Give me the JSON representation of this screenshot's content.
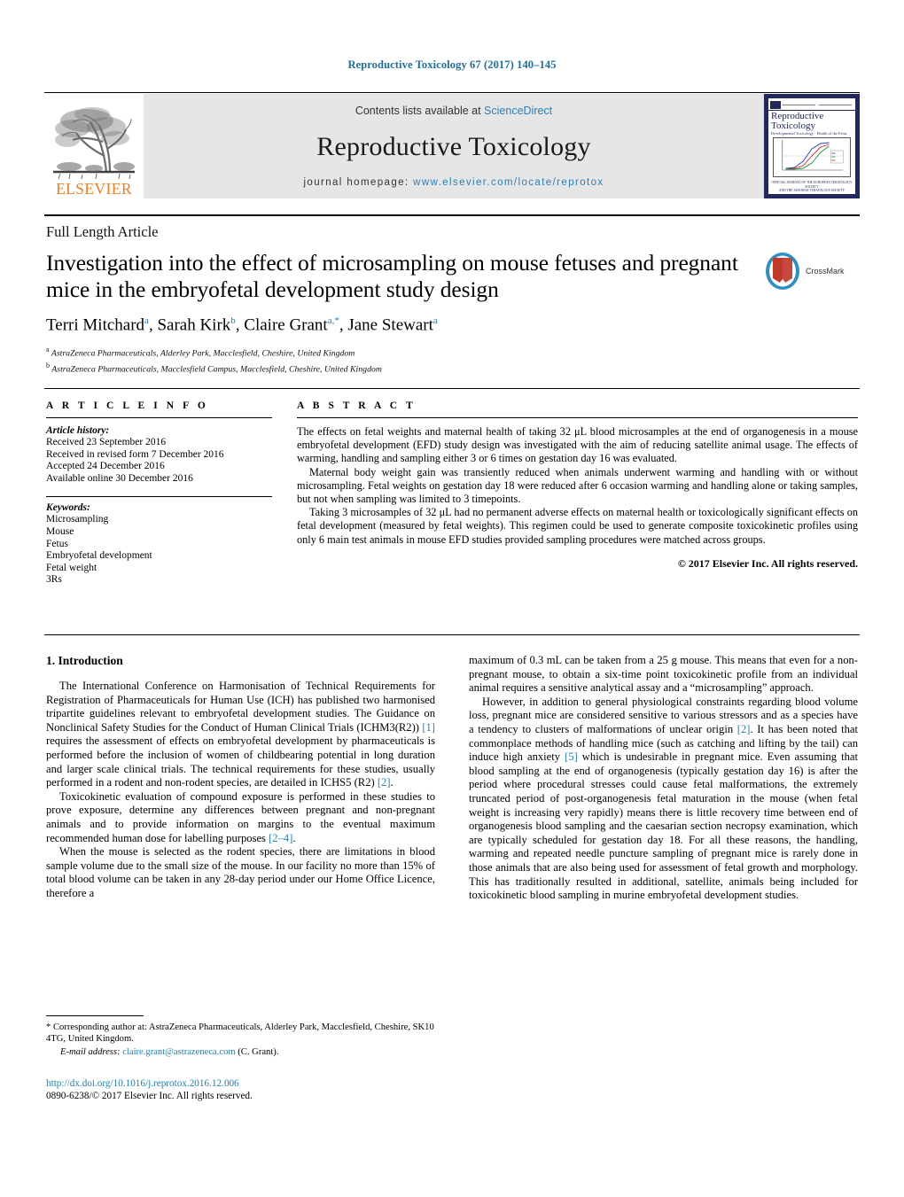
{
  "running_head": "Reproductive Toxicology 67 (2017) 140–145",
  "masthead": {
    "contents_prefix": "Contents lists available at ",
    "sciencedirect": "ScienceDirect",
    "journal_name": "Reproductive Toxicology",
    "homepage_prefix": "journal homepage: ",
    "homepage_url": "www.elsevier.com/locate/reprotox",
    "publisher": "ELSEVIER",
    "cover": {
      "title_line1": "Reproductive",
      "title_line2": "Toxicology",
      "subtitle": "Developmental Toxicology · Health of the Fetus",
      "footer_line1": "OFFICIAL JOURNAL OF THE EUROPEAN TERATOLOGY SOCIETY",
      "footer_line2": "AND THE JAPANESE TERATOLOGY SOCIETY"
    }
  },
  "article": {
    "type": "Full Length Article",
    "title": "Investigation into the effect of microsampling on mouse fetuses and pregnant mice in the embryofetal development study design",
    "authors": [
      {
        "name": "Terri Mitchard",
        "marks": "a",
        "sep": ", "
      },
      {
        "name": "Sarah Kirk",
        "marks": "b",
        "sep": ", "
      },
      {
        "name": "Claire Grant",
        "marks": "a,*",
        "sep": ", "
      },
      {
        "name": "Jane Stewart",
        "marks": "a",
        "sep": ""
      }
    ],
    "affiliations": [
      {
        "mark": "a",
        "text": "AstraZeneca Pharmaceuticals, Alderley Park, Macclesfield, Cheshire, United Kingdom"
      },
      {
        "mark": "b",
        "text": "AstraZeneca Pharmaceuticals, Macclesfield Campus, Macclesfield, Cheshire, United Kingdom"
      }
    ],
    "crossmark_label": "CrossMark"
  },
  "article_info": {
    "heading": "A R T I C L E   I N F O",
    "history_title": "Article history:",
    "history": [
      "Received 23 September 2016",
      "Received in revised form 7 December 2016",
      "Accepted 24 December 2016",
      "Available online 30 December 2016"
    ],
    "keywords_title": "Keywords:",
    "keywords": [
      "Microsampling",
      "Mouse",
      "Fetus",
      "Embryofetal development",
      "Fetal weight",
      "3Rs"
    ]
  },
  "abstract": {
    "heading": "A B S T R A C T",
    "paragraphs": [
      "The effects on fetal weights and maternal health of taking 32 μL blood microsamples at the end of organogenesis in a mouse embryofetal development (EFD) study design was investigated with the aim of reducing satellite animal usage. The effects of warming, handling and sampling either 3 or 6 times on gestation day 16 was evaluated.",
      "Maternal body weight gain was transiently reduced when animals underwent warming and handling with or without microsampling. Fetal weights on gestation day 18 were reduced after 6 occasion warming and handling alone or taking samples, but not when sampling was limited to 3 timepoints.",
      "Taking 3 microsamples of 32 μL had no permanent adverse effects on maternal health or toxicologically significant effects on fetal development (measured by fetal weights). This regimen could be used to generate composite toxicokinetic profiles using only 6 main test animals in mouse EFD studies provided sampling procedures were matched across groups."
    ],
    "copyright": "© 2017 Elsevier Inc. All rights reserved."
  },
  "body": {
    "section_heading": "1. Introduction",
    "left_paragraphs": [
      "The International Conference on Harmonisation of Technical Requirements for Registration of Pharmaceuticals for Human Use (ICH) has published two harmonised tripartite guidelines relevant to embryofetal development studies. The Guidance on Nonclinical Safety Studies for the Conduct of Human Clinical Trials (ICHM3(R2)) [1] requires the assessment of effects on embryofetal development by pharmaceuticals is performed before the inclusion of women of childbearing potential in long duration and larger scale clinical trials. The technical requirements for these studies, usually performed in a rodent and non-rodent species, are detailed in ICHS5 (R2) [2].",
      "Toxicokinetic evaluation of compound exposure is performed in these studies to prove exposure, determine any differences between pregnant and non-pregnant animals and to provide information on margins to the eventual maximum recommended human dose for labelling purposes [2–4].",
      "When the mouse is selected as the rodent species, there are limitations in blood sample volume due to the small size of the mouse. In our facility no more than 15% of total blood volume can be taken in any 28-day period under our Home Office Licence, therefore a"
    ],
    "right_paragraphs": [
      "maximum of 0.3 mL can be taken from a 25 g mouse. This means that even for a non-pregnant mouse, to obtain a six-time point toxicokinetic profile from an individual animal requires a sensitive analytical assay and a “microsampling” approach.",
      "However, in addition to general physiological constraints regarding blood volume loss, pregnant mice are considered sensitive to various stressors and as a species have a tendency to clusters of malformations of unclear origin [2]. It has been noted that commonplace methods of handling mice (such as catching and lifting by the tail) can induce high anxiety [5] which is undesirable in pregnant mice. Even assuming that blood sampling at the end of organogenesis (typically gestation day 16) is after the period where procedural stresses could cause fetal malformations, the extremely truncated period of post-organogenesis fetal maturation in the mouse (when fetal weight is increasing very rapidly) means there is little recovery time between end of organogenesis blood sampling and the caesarian section necropsy examination, which are typically scheduled for gestation day 18. For all these reasons, the handling, warming and repeated needle puncture sampling of pregnant mice is rarely done in those animals that are also being used for assessment of fetal growth and morphology. This has traditionally resulted in additional, satellite, animals being included for toxicokinetic blood sampling in murine embryofetal development studies."
    ]
  },
  "footnotes": {
    "corresponding": "* Corresponding author at: AstraZeneca Pharmaceuticals, Alderley Park, Macclesfield, Cheshire, SK10 4TG, United Kingdom.",
    "email_label": "E-mail address:",
    "email": "claire.grant@astrazeneca.com",
    "email_owner": "(C. Grant).",
    "doi": "http://dx.doi.org/10.1016/j.reprotox.2016.12.006",
    "issn": "0890-6238/© 2017 Elsevier Inc. All rights reserved."
  },
  "colors": {
    "link": "#1f7fae",
    "elsevier_orange": "#ef7d22",
    "cover_navy": "#20285e",
    "masthead_gray": "#e6e6e6"
  }
}
